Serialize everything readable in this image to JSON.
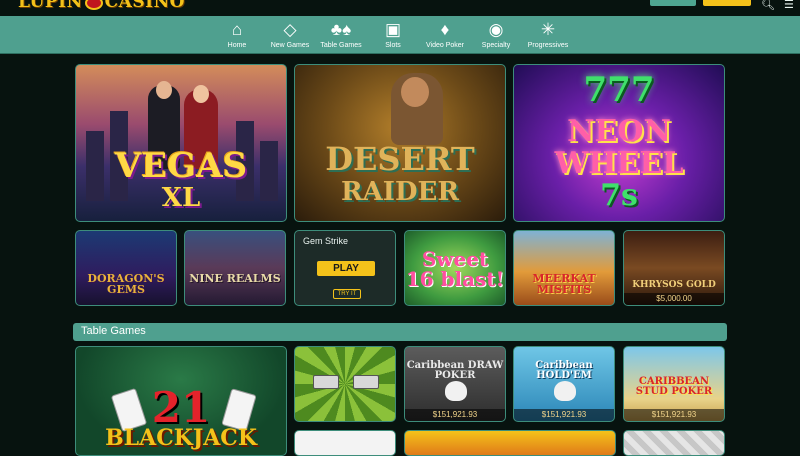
{
  "header": {
    "logo_text": "LUPIN CASINO",
    "brand_color": "#f4c21a",
    "icons": [
      "search-icon",
      "menu-icon"
    ]
  },
  "nav": {
    "items": [
      {
        "label": "Home",
        "icon": "home-icon"
      },
      {
        "label": "New Games",
        "icon": "diamond-icon"
      },
      {
        "label": "Table Games",
        "icon": "card-suits-icon"
      },
      {
        "label": "Slots",
        "icon": "slot-machine-icon"
      },
      {
        "label": "Video Poker",
        "icon": "playing-cards-icon"
      },
      {
        "label": "Specialty",
        "icon": "roulette-icon"
      },
      {
        "label": "Progressives",
        "icon": "progressive-burst-icon"
      }
    ]
  },
  "featured": [
    {
      "title_line1": "VEGAS",
      "title_line2": "XL"
    },
    {
      "title_line1": "DESERT",
      "title_line2": "RAIDER"
    },
    {
      "title_line0": "777",
      "title_line1": "NEON",
      "title_line2": "WHEEL",
      "title_line3": "7s"
    }
  ],
  "games": [
    {
      "title": "DORAGON'S GEMS"
    },
    {
      "title": "NINE REALMS"
    },
    {
      "name": "Gem Strike",
      "play_label": "PLAY",
      "try_label": "TRY IT"
    },
    {
      "title": "Sweet 16 blast!"
    },
    {
      "title": "MEERKAT MISFITS"
    },
    {
      "title": "KHRYSOS GOLD",
      "jackpot": "$5,000.00"
    }
  ],
  "table_games": {
    "section_title": "Table Games",
    "blackjack": {
      "title_line1": "21",
      "title_line2": "BLACKJACK"
    },
    "tiles": [
      {
        "title": ""
      },
      {
        "title": "Caribbean DRAW POKER",
        "jackpot": "$151,921.93"
      },
      {
        "title": "Caribbean HOLD'EM",
        "jackpot": "$151,921.93"
      },
      {
        "title": "CARIBBEAN STUD POKER",
        "jackpot": "$151,921.93"
      }
    ]
  },
  "colors": {
    "nav_bg": "#4fa08f",
    "page_bg": "#07130f",
    "accent": "#f4c21a"
  }
}
